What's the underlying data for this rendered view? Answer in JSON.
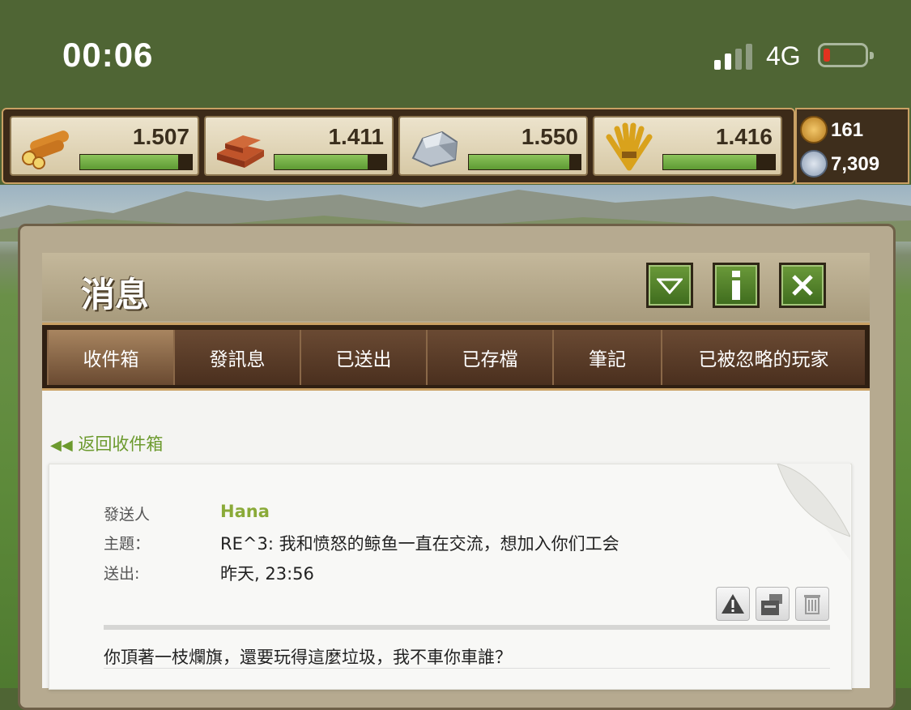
{
  "status_bar": {
    "time": "00:06",
    "network": "4G"
  },
  "resources": [
    {
      "name": "wood-icon",
      "value": "1.507",
      "fill": 0.88
    },
    {
      "name": "brick-icon",
      "value": "1.411",
      "fill": 0.83
    },
    {
      "name": "iron-icon",
      "value": "1.550",
      "fill": 0.9
    },
    {
      "name": "crop-icon",
      "value": "1.416",
      "fill": 0.83
    }
  ],
  "currency": {
    "gold": "161",
    "silver": "7,309"
  },
  "dialog": {
    "title": "消息",
    "tabs": [
      "收件箱",
      "發訊息",
      "已送出",
      "已存檔",
      "筆記",
      "已被忽略的玩家"
    ],
    "active_tab": 0,
    "back_link": "返回收件箱",
    "message": {
      "sender_label": "發送人",
      "sender": "Hana",
      "subject_label": "主題：",
      "subject": "RE^3: 我和愤怒的鲸鱼一直在交流，想加入你们工会",
      "sent_label": "送出:",
      "sent": "昨天, 23:56",
      "body": "你頂著一枝爛旗，還要玩得這麼垃圾，我不車你車誰？"
    }
  },
  "colors": {
    "accent_green": "#8aaa38",
    "link_green": "#6c9a2e",
    "status_bg": "#4f6534"
  }
}
